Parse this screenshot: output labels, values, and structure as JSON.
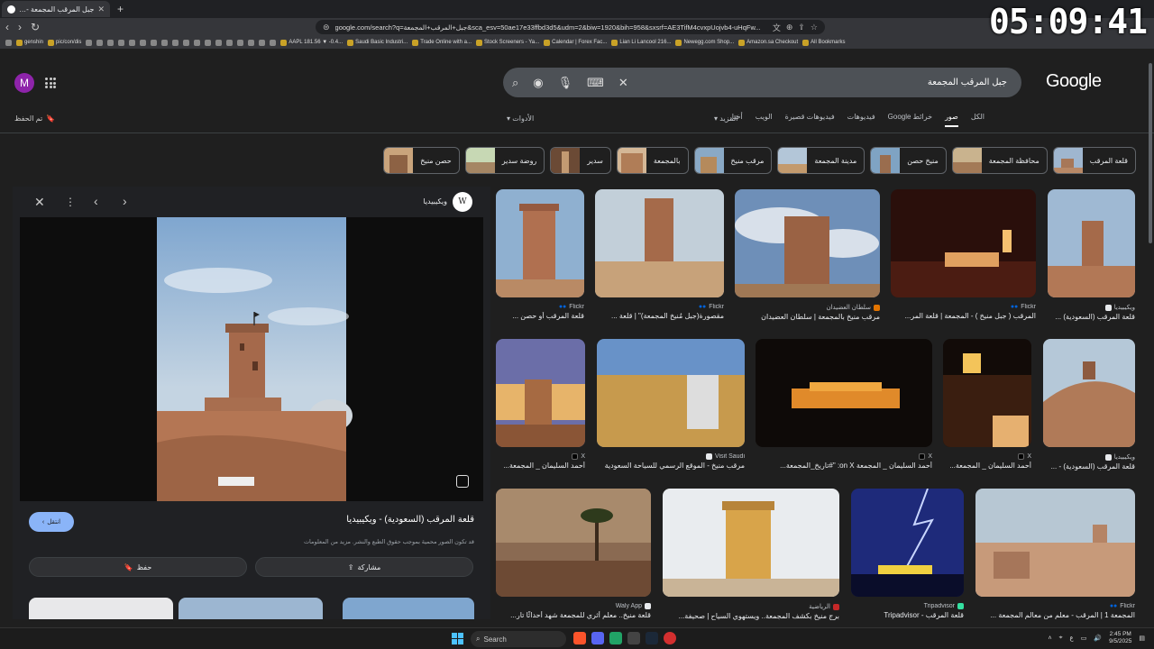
{
  "browser": {
    "tab_title": "جبل المرقب المجمعة - بحث Google",
    "url": "google.com/search?q=جبل+المرقب+المجمعة&sca_esv=50ae17e33ffbd3d5&udm=2&biw=1920&bih=958&sxsrf=AE3TifM4cvxpUojvb4-uHqFw...",
    "clock": "05:09:41",
    "bookmarks": [
      "genshin",
      "pic/con/dis",
      "AAPL 181.56 ▼ -0.4...",
      "Saudi Basic Industri...",
      "Trade Online with a...",
      "Stock Screeners - Ya...",
      "Calendar | Forex Fac...",
      "Lian Li Lancool 216...",
      "Newegg.com Shop...",
      "Amazon.sa Checkout",
      "All Bookmarks"
    ]
  },
  "google": {
    "logo": "Google",
    "avatar_letter": "M",
    "query": "جبل المرقب المجمعة",
    "saved": "تم الحفظ",
    "tabs": [
      "الكل",
      "صور",
      "خرائط Google",
      "فيديوهات",
      "فيديوهات قصيرة",
      "الويب",
      "أخبار"
    ],
    "more": "المزيد",
    "tools": "الأدوات",
    "chips": [
      "قلعة المرقب",
      "محافظة المجمعة",
      "منيخ حصن",
      "مدينة المجمعة",
      "مرقب منيخ",
      "بالمجمعة",
      "سدير",
      "روضة سدير",
      "حصن منيخ"
    ]
  },
  "panel": {
    "source": "ويكيبيديا",
    "source_logo": "W",
    "title": "قلعة المرقب (السعودية) - ويكيبيديا",
    "desc": "قد تكون الصور محمية بموجب حقوق الطبع والنشر. مزيد من المعلومات",
    "visit": "انتقل",
    "share": "مشاركة",
    "save": "حفظ"
  },
  "results": [
    {
      "src": "Flickr",
      "cap": "قلعة المرقب أو حصن ..."
    },
    {
      "src": "Flickr",
      "cap": "مقصورة(جبل مُنيخ المجمعة)\" | قلعة ..."
    },
    {
      "src": "سلطان العضيدان",
      "cap": "مرقب منيخ بالمجمعة | سلطان العضيدان"
    },
    {
      "src": "Flickr",
      "cap": "المرقب ( جبل منيخ ) - المجمعة | قلعة المر..."
    },
    {
      "src": "ويكيبيديا",
      "cap": "قلعة المرقب (السعودية) ..."
    },
    {
      "src": "X",
      "cap": "أحمد السليمان _ المجمعة..."
    },
    {
      "src": "Visit Saudi",
      "cap": "مرقب منيخ - الموقع الرسمي للسياحة السعودية"
    },
    {
      "src": "X",
      "cap": "أحمد السليمان _ المجمعة on X: \"#تاريخ_المجمعة..."
    },
    {
      "src": "X",
      "cap": "أحمد السليمان _ المجمعة..."
    },
    {
      "src": "ويكيبيديا",
      "cap": "قلعة المرقب (السعودية) - ..."
    },
    {
      "src": "Waly App",
      "cap": "قلعة منيخ.. معلم أثري للمجمعة شهد أحداثًا تار..."
    },
    {
      "src": "الرياضية",
      "cap": "برج منيخ بكشف المجمعة.. ويستهوي السياح | صحيفة..."
    },
    {
      "src": "Tripadvisor",
      "cap": "قلعة المرقب - Tripadvisor"
    },
    {
      "src": "Flickr",
      "cap": "المجمعة 1 | المرقب - معلم من معالم المجمعة ..."
    }
  ],
  "taskbar": {
    "search": "Search",
    "time": "2:45 PM",
    "date": "9/5/2025"
  }
}
